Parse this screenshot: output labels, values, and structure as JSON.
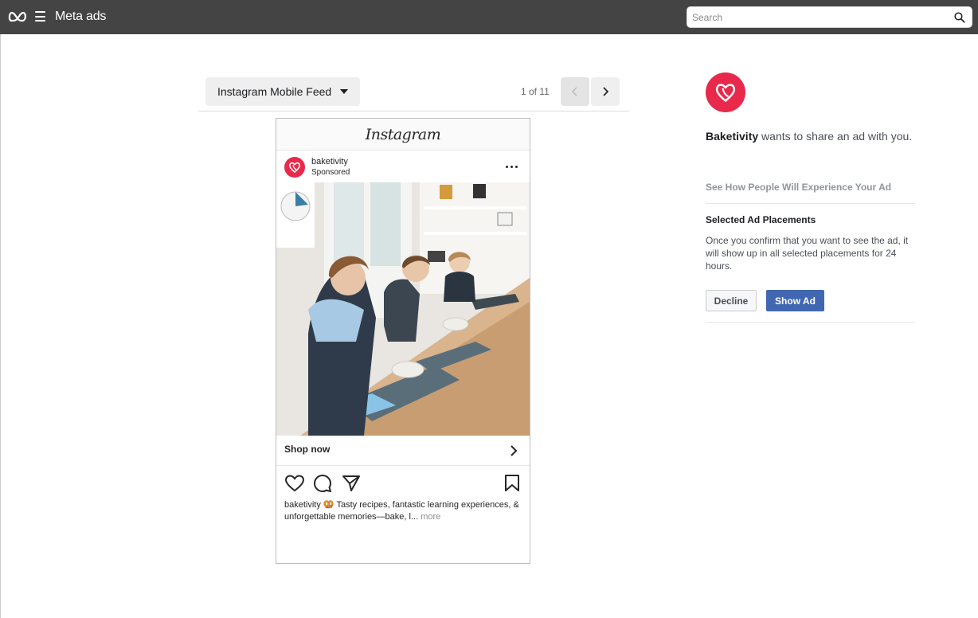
{
  "header": {
    "app_title": "Meta ads",
    "search_placeholder": "Search",
    "icons": [
      "meta-logo",
      "menu-icon",
      "search-icon"
    ]
  },
  "placement": {
    "selected": "Instagram Mobile Feed",
    "pager": "1 of 11"
  },
  "ad_preview": {
    "platform_wordmark": "Instagram",
    "username": "baketivity",
    "sponsored": "Sponsored",
    "cta_label": "Shop now",
    "caption_user": "baketivity",
    "caption_emoji": "🥨",
    "caption_text": "Tasty recipes, fantastic learning experiences, & unforgettable memories—bake, l...",
    "caption_more": "more",
    "icons": [
      "heart-icon",
      "comment-icon",
      "share-icon",
      "bookmark-icon"
    ]
  },
  "panel": {
    "advertiser": "Baketivity",
    "share_text": " wants to share an ad with you.",
    "see_how": "See How People Will Experience Your Ad",
    "selected_title": "Selected Ad Placements",
    "selected_body": "Once you confirm that you want to see the ad, it will show up in all selected placements for 24 hours.",
    "decline_label": "Decline",
    "show_label": "Show Ad"
  },
  "colors": {
    "topbar": "#444444",
    "brand_red": "#e8294c",
    "primary_button": "#4267b2"
  }
}
